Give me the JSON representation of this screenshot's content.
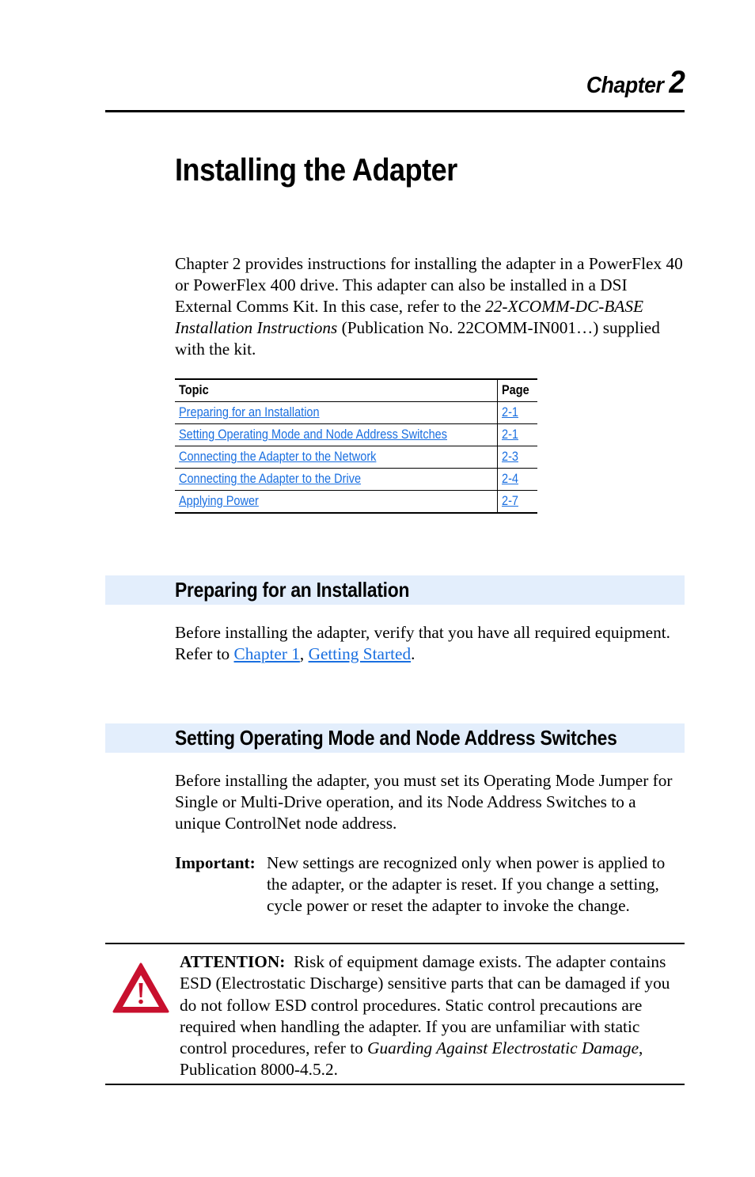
{
  "header": {
    "chapter_label": "Chapter",
    "chapter_number": "2"
  },
  "page_title": "Installing the Adapter",
  "intro": {
    "text_before_italic": "Chapter 2 provides instructions for installing the adapter in a PowerFlex 40 or PowerFlex 400 drive. This adapter can also be installed in a DSI External Comms Kit. In this case, refer to the ",
    "italic_ref": "22-XCOMM-DC-BASE Installation Instructions",
    "text_after_italic": " (Publication No. 22COMM-IN001…) supplied with the kit."
  },
  "topics_table": {
    "headers": [
      "Topic",
      "Page"
    ],
    "rows": [
      {
        "topic": "Preparing for an Installation",
        "page": "2-1"
      },
      {
        "topic": "Setting Operating Mode and Node Address Switches",
        "page": "2-1"
      },
      {
        "topic": "Connecting the Adapter to the Network",
        "page": "2-3"
      },
      {
        "topic": "Connecting the Adapter to the Drive",
        "page": "2-4"
      },
      {
        "topic": "Applying Power",
        "page": "2-7"
      }
    ]
  },
  "sections": [
    {
      "heading": "Preparing for an Installation",
      "text_before": "Before installing the adapter, verify that you have all required equipment. Refer to ",
      "link1": "Chapter 1",
      "separator": ", ",
      "link2": "Getting Started",
      "text_after": "."
    },
    {
      "heading": "Setting Operating Mode and Node Address Switches",
      "text": "Before installing the adapter, you must set its Operating Mode Jumper for Single or Multi-Drive operation, and its Node Address Switches to a unique ControlNet node address."
    }
  ],
  "important": {
    "label": "Important:",
    "text": "New settings are recognized only when power is applied to the adapter, or the adapter is reset. If you change a setting, cycle power or reset the adapter to invoke the change."
  },
  "attention": {
    "icon": "warning-triangle-icon",
    "label": "ATTENTION:",
    "text_before_italic": "  Risk of equipment damage exists. The adapter contains ESD (Electrostatic Discharge) sensitive parts that can be damaged if you do not follow ESD control procedures. Static control precautions are required when handling the adapter. If you are unfamiliar with static control procedures, refer to ",
    "italic_ref": "Guarding Against Electrostatic Damage",
    "text_after_italic": ", Publication 8000-4.5.2."
  },
  "colors": {
    "link": "#1a6fe0",
    "section_band": "#e3eefc",
    "warning_red": "#c8102e"
  }
}
